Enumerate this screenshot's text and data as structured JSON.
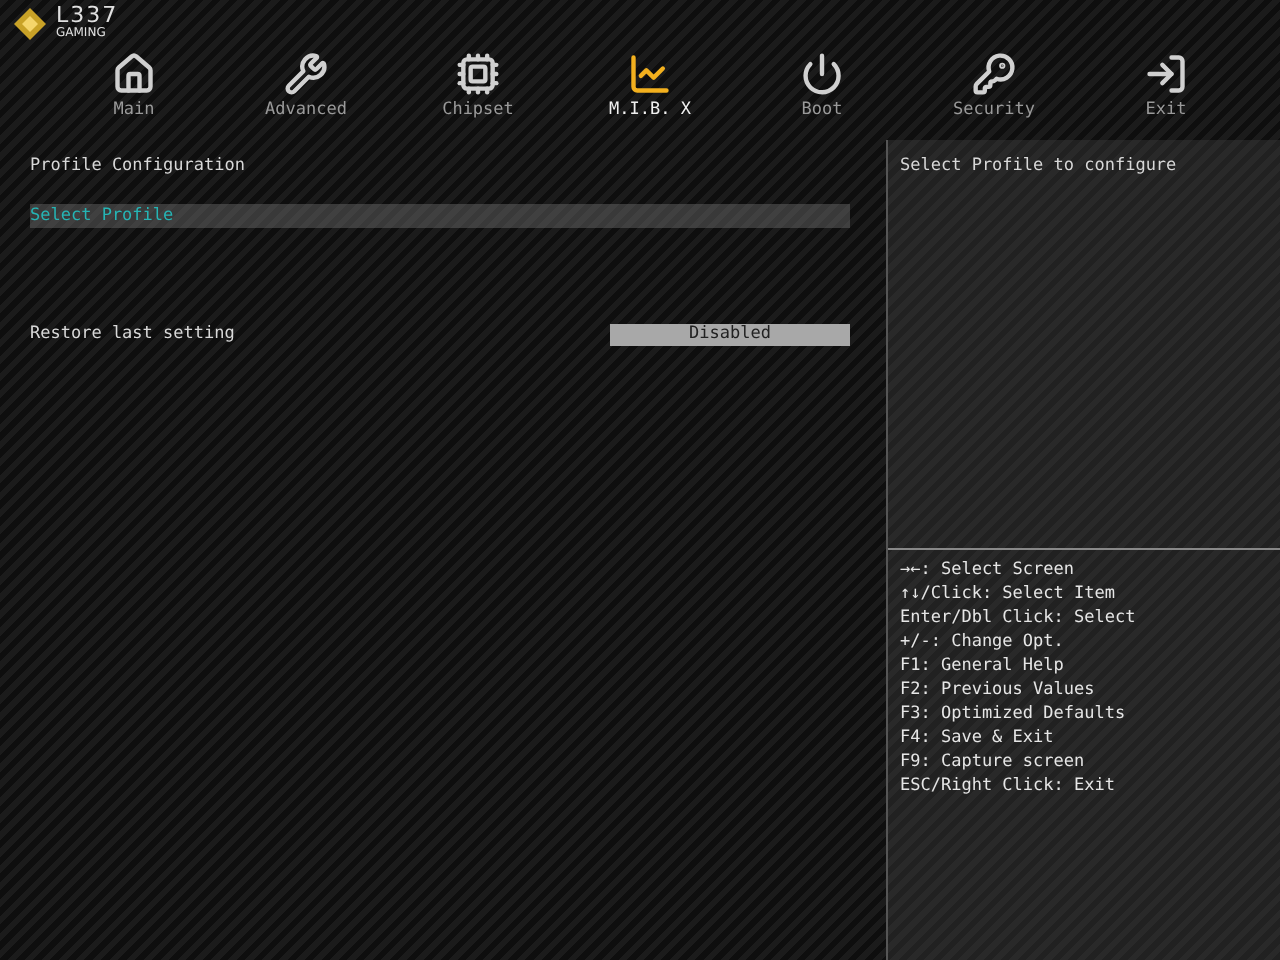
{
  "logo": {
    "name": "L337",
    "subtitle": "GAMING"
  },
  "tabs": [
    {
      "label": "Main",
      "kind": "home",
      "selected": false
    },
    {
      "label": "Advanced",
      "kind": "wrench",
      "selected": false
    },
    {
      "label": "Chipset",
      "kind": "chip",
      "selected": false
    },
    {
      "label": "M.I.B. X",
      "kind": "chart",
      "selected": true
    },
    {
      "label": "Boot",
      "kind": "power",
      "selected": false
    },
    {
      "label": "Security",
      "kind": "key",
      "selected": false
    },
    {
      "label": "Exit",
      "kind": "exit",
      "selected": false
    }
  ],
  "section_title": "Profile Configuration",
  "items": [
    {
      "kind": "submenu",
      "label": "Select Profile",
      "selected": true
    },
    {
      "kind": "gap"
    },
    {
      "kind": "option",
      "label": "Restore last setting",
      "value": "Disabled",
      "selected": false
    }
  ],
  "help_text": "Select Profile to configure",
  "key_help": [
    "→←: Select Screen",
    "↑↓/Click: Select Item",
    "Enter/Dbl Click: Select",
    "+/-: Change Opt.",
    "F1: General Help",
    "F2: Previous Values",
    "F3: Optimized Defaults",
    "F4: Save & Exit",
    "F9: Capture screen",
    "ESC/Right Click: Exit"
  ]
}
